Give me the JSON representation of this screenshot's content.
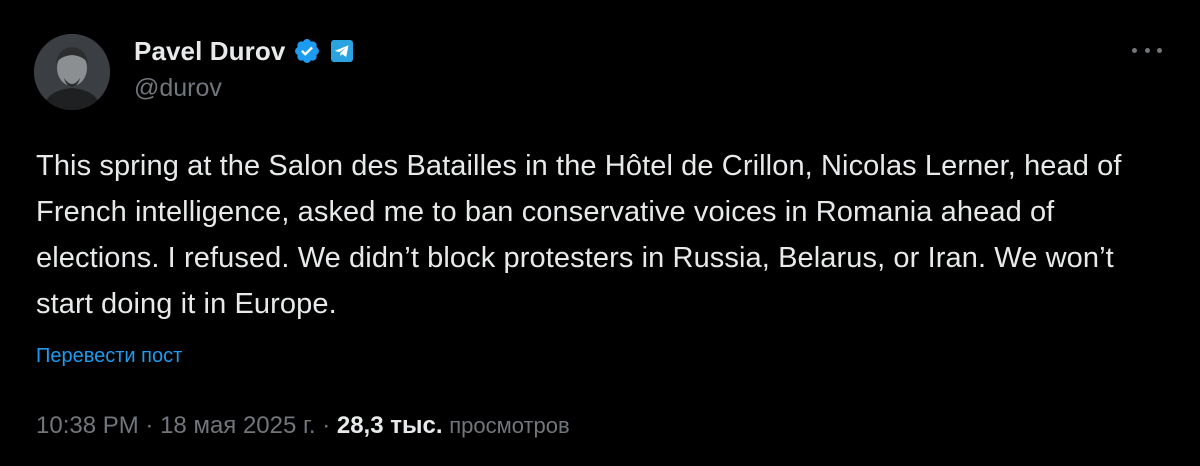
{
  "author": {
    "name": "Pavel Durov",
    "handle": "@durov",
    "verified": true,
    "badge_color": "#1d9bf0",
    "secondary_badge": "telegram-icon"
  },
  "tweet": {
    "text": "This spring at the Salon des Batailles in the Hôtel de Crillon, Nicolas Lerner, head of French intelligence, asked me to ban conservative voices in Romania ahead of elections. I refused. We didn’t block protesters in Russia, Belarus, or Iran. We won’t start doing it in Europe.",
    "translate_label": "Перевести пост"
  },
  "meta": {
    "time": "10:38 PM",
    "separator": "·",
    "date": "18 мая 2025 г.",
    "views_count": "28,3 тыс.",
    "views_label": "просмотров"
  },
  "colors": {
    "background": "#000000",
    "text": "#e7e9ea",
    "muted": "#71767b",
    "link": "#1d9bf0"
  }
}
